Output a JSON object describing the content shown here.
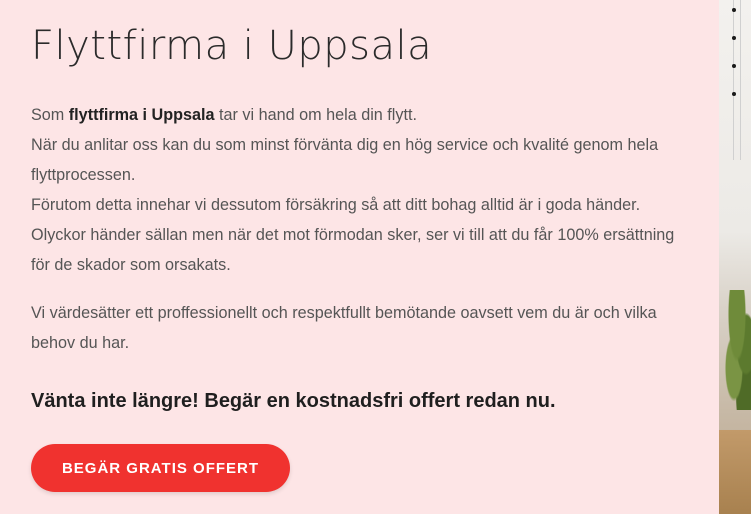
{
  "page": {
    "title": "Flyttfirma i Uppsala"
  },
  "intro": {
    "line1_prefix": "Som ",
    "line1_bold": "flyttfirma i Uppsala",
    "line1_suffix": " tar vi hand om hela din flytt.",
    "line2": "När du anlitar oss kan du som minst förvänta dig en hög service och kvalité genom hela",
    "line3": "flyttprocessen.",
    "line4": "Förutom detta innehar vi dessutom försäkring så att ditt bohag alltid är i goda händer.",
    "line5": "Olyckor händer sällan men när det mot förmodan sker, ser vi till att du får 100% ersättning",
    "line6": "för de skador som orsakats."
  },
  "values": {
    "line1": "Vi värdesätter ett proffessionellt och respektfullt bemötande oavsett vem du är och vilka",
    "line2": "behov du har."
  },
  "cta": {
    "heading": "Vänta inte längre! Begär en kostnadsfri offert redan nu.",
    "button_label": "BEGÄR GRATIS OFFERT"
  },
  "colors": {
    "background": "#fde5e6",
    "cta_button": "#f0322f"
  }
}
